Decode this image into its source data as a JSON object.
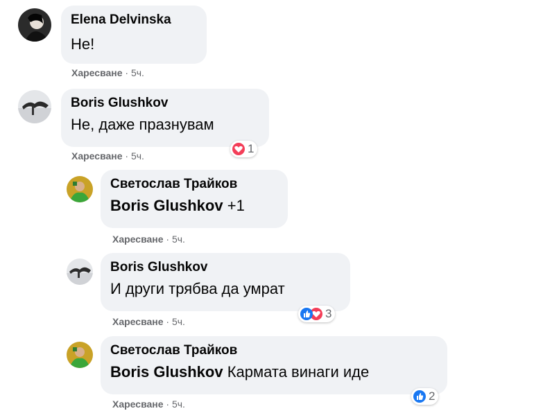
{
  "comments": [
    {
      "author": "Elena Delvinska",
      "text": "Не!",
      "like_label": "Харесване",
      "time": "5ч."
    },
    {
      "author": "Boris Glushkov",
      "text": "Не, даже празнувам",
      "like_label": "Харесване",
      "time": "5ч.",
      "reactions": {
        "count": "1",
        "icons": [
          "love"
        ]
      }
    },
    {
      "author": "Светослав Трайков",
      "mention": "Boris Glushkov",
      "text": "+1",
      "like_label": "Харесване",
      "time": "5ч."
    },
    {
      "author": "Boris Glushkov",
      "text": "И други трябва да умрат",
      "like_label": "Харесване",
      "time": "5ч.",
      "reactions": {
        "count": "3",
        "icons": [
          "like",
          "love"
        ]
      }
    },
    {
      "author": "Светослав Трайков",
      "mention": "Boris Glushkov",
      "text": "Кармата винаги иде",
      "like_label": "Харесване",
      "time": "5ч.",
      "reactions": {
        "count": "2",
        "icons": [
          "like"
        ]
      }
    }
  ],
  "meta_separator": "·",
  "colors": {
    "bubble": "#f0f2f5",
    "meta": "#65676b",
    "like": "#1877f2",
    "love": "#f33e58"
  }
}
